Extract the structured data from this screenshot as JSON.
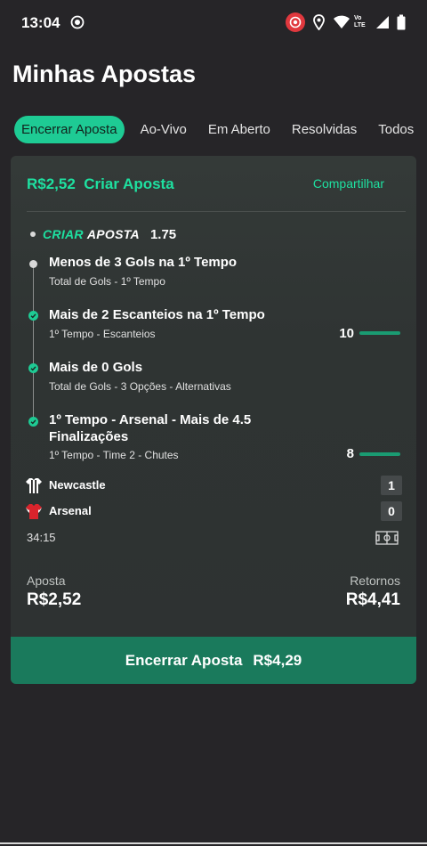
{
  "status_bar": {
    "time": "13:04",
    "icons": [
      "screen-record-icon",
      "recording-indicator-icon",
      "location-icon",
      "wifi-icon",
      "volte-icon",
      "signal-icon",
      "battery-icon"
    ],
    "volte_text": "Vo LTE"
  },
  "page": {
    "title": "Minhas Apostas"
  },
  "tabs": [
    {
      "label": "Encerrar Aposta",
      "active": true
    },
    {
      "label": "Ao-Vivo"
    },
    {
      "label": "Em Aberto"
    },
    {
      "label": "Resolvidas"
    },
    {
      "label": "Todos"
    }
  ],
  "bet": {
    "amount_title": "R$2,52  Criar Aposta",
    "share_label": "Compartilhar",
    "bet_builder": {
      "criar": "CRIAR",
      "aposta": "APOSTA",
      "odd": "1.75"
    },
    "selections": [
      {
        "title": "Menos de 3 Gols na 1º Tempo",
        "subtitle": "Total de Gols - 1º Tempo",
        "status": "pending"
      },
      {
        "title": "Mais de 2 Escanteios na 1º Tempo",
        "subtitle": "1º Tempo - Escanteios",
        "status": "won",
        "stat": "10"
      },
      {
        "title": "Mais de 0 Gols",
        "subtitle": "Total de Gols - 3 Opções - Alternativas",
        "status": "won"
      },
      {
        "title_line1": "1º Tempo - Arsenal - Mais de 4.5",
        "title_line2": "Finalizações",
        "subtitle": "1º Tempo - Time 2 - Chutes",
        "status": "won",
        "stat": "8"
      }
    ],
    "match": {
      "home": {
        "name": "Newcastle",
        "score": "1",
        "icon": "newcastle-kit-icon"
      },
      "away": {
        "name": "Arsenal",
        "score": "0",
        "icon": "arsenal-kit-icon"
      },
      "clock": "34:15"
    },
    "stake_label": "Aposta",
    "stake_value": "R$2,52",
    "returns_label": "Retornos",
    "returns_value": "R$4,41",
    "cashout_label": "Encerrar Aposta",
    "cashout_value": "R$4,29"
  },
  "colors": {
    "accent": "#1ee0a0",
    "tab_active_bg": "#1ecb94",
    "cashout_bg": "#1a7a5c",
    "background": "#262528",
    "card_bg": "#2f3433"
  }
}
